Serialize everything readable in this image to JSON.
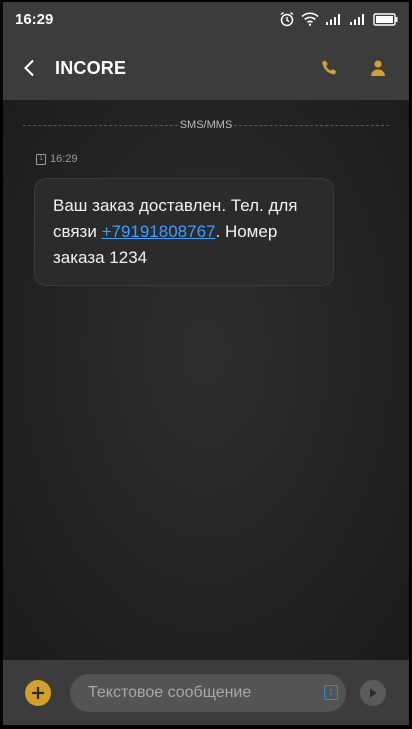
{
  "statusbar": {
    "time": "16:29",
    "icons": [
      "alarm-clock-icon",
      "wifi-icon",
      "signal-icon",
      "signal-icon",
      "battery-icon"
    ]
  },
  "header": {
    "title": "INCORE",
    "icons": [
      "back-chevron-icon",
      "phone-icon",
      "contact-person-icon"
    ],
    "accent_color": "#d4a028"
  },
  "thread": {
    "channel_label": "SMS/MMS",
    "messages": [
      {
        "sim_label": "1",
        "time": "16:29",
        "text_before": "Ваш заказ доставлен. Тел. для связи ",
        "phone_link": "+79191808767",
        "text_after": ". Номер заказа 1234",
        "link_color": "#3aa0ff"
      }
    ]
  },
  "composer": {
    "placeholder": "Текстовое сообщение",
    "sim_label": "1",
    "icons": [
      "plus-icon",
      "sim-select-icon",
      "send-icon"
    ]
  }
}
